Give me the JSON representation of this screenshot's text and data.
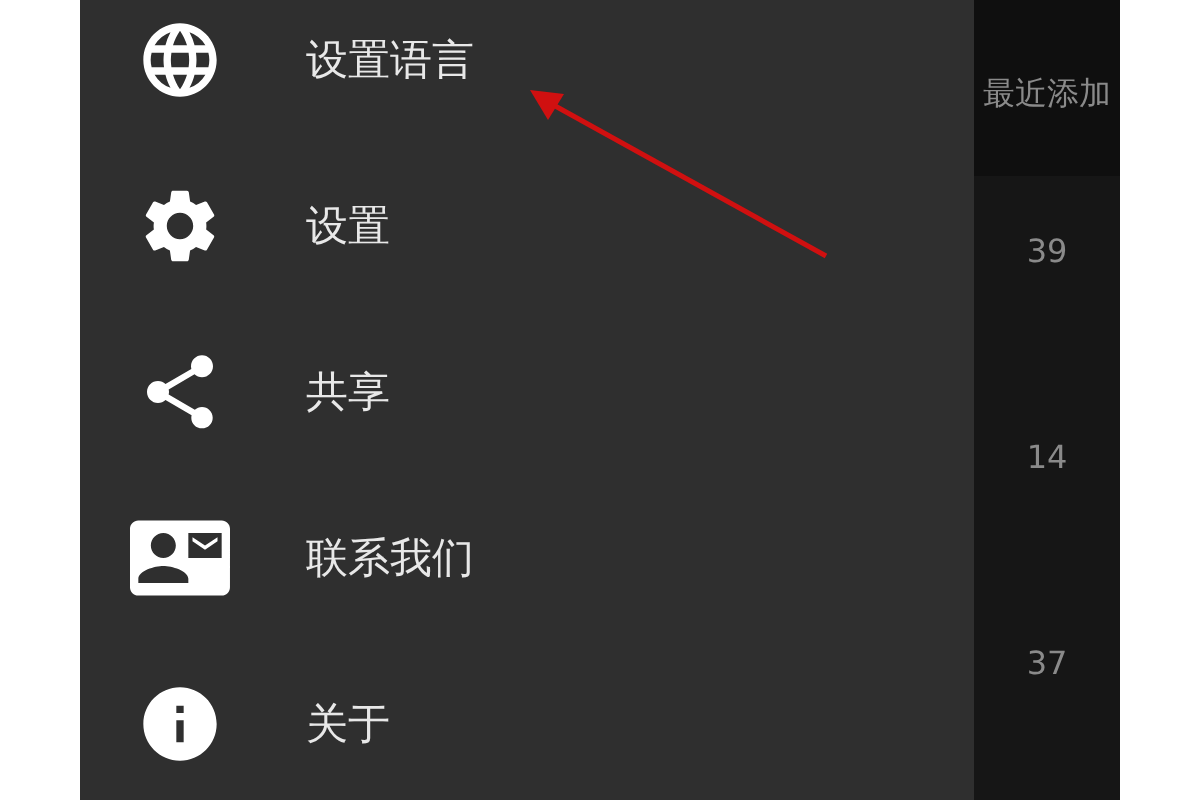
{
  "drawer": {
    "items": [
      {
        "kind": "language",
        "label": "设置语言"
      },
      {
        "kind": "settings",
        "label": "设置"
      },
      {
        "kind": "share",
        "label": "共享"
      },
      {
        "kind": "contact",
        "label": "联系我们"
      },
      {
        "kind": "info",
        "label": "关于"
      }
    ]
  },
  "background_list": {
    "header": "最近添加",
    "values": [
      "39",
      "14",
      "37"
    ]
  }
}
